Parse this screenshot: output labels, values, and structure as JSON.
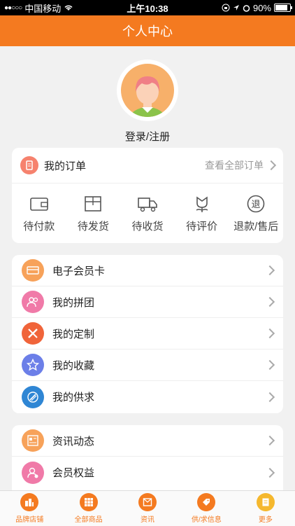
{
  "status_bar": {
    "signal": "●●○○○",
    "carrier": "中国移动",
    "time": "上午10:38",
    "battery": "90%"
  },
  "nav": {
    "title": "个人中心"
  },
  "profile": {
    "login_label": "登录/注册"
  },
  "orders": {
    "title": "我的订单",
    "view_all": "查看全部订单",
    "items": [
      {
        "label": "待付款",
        "icon": "wallet-icon"
      },
      {
        "label": "待发货",
        "icon": "box-icon"
      },
      {
        "label": "待收货",
        "icon": "truck-icon"
      },
      {
        "label": "待评价",
        "icon": "flower-icon"
      },
      {
        "label": "退款/售后",
        "icon": "refund-icon",
        "glyph": "退"
      }
    ]
  },
  "menu1": [
    {
      "label": "电子会员卡",
      "icon": "card-icon",
      "color": "#f7a25a"
    },
    {
      "label": "我的拼团",
      "icon": "group-icon",
      "color": "#f07aa8"
    },
    {
      "label": "我的定制",
      "icon": "pencil-ruler-icon",
      "color": "#f0643a"
    },
    {
      "label": "我的收藏",
      "icon": "star-icon",
      "color": "#6c7fe8"
    },
    {
      "label": "我的供求",
      "icon": "compass-icon",
      "color": "#2f86d4"
    }
  ],
  "menu2": [
    {
      "label": "资讯动态",
      "icon": "news-icon",
      "color": "#f7a25a"
    },
    {
      "label": "会员权益",
      "icon": "member-icon",
      "color": "#f07aa8"
    }
  ],
  "tabs": [
    {
      "label": "品牌店铺",
      "icon": "shop-icon"
    },
    {
      "label": "全部商品",
      "icon": "grid-icon"
    },
    {
      "label": "资讯",
      "icon": "newspaper-icon"
    },
    {
      "label": "供/求信息",
      "icon": "tag-icon"
    },
    {
      "label": "更多",
      "icon": "more-icon"
    }
  ]
}
